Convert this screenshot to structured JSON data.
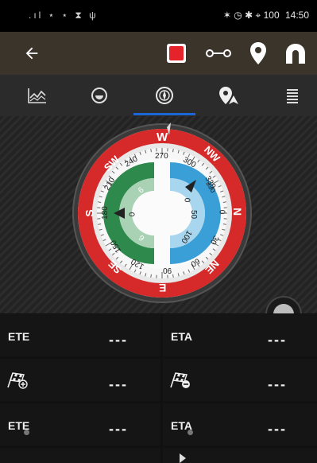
{
  "status_bar": {
    "left_icons": ".ıl ⋆ ⋆ ⧗ ψ",
    "right_icons": "✶ ◷ ✱ ⌖ 100",
    "time": "14:50"
  },
  "toolbar": {
    "back_icon": "arrow-left-icon",
    "record_icon": "record-icon",
    "route_icon": "route-icon",
    "pin_icon": "location-pin-icon",
    "magnet_icon": "magnet-icon"
  },
  "tabs": [
    {
      "icon": "chart-icon",
      "active": false
    },
    {
      "icon": "gauge-icon",
      "active": false
    },
    {
      "icon": "compass-icon",
      "active": true
    },
    {
      "icon": "navigation-pin-icon",
      "active": false
    },
    {
      "icon": "list-icon",
      "active": false
    }
  ],
  "compass": {
    "heading": "W",
    "cardinals": [
      "W",
      "NW",
      "N",
      "NE",
      "E",
      "SE",
      "S",
      "SW"
    ],
    "degree_labels": [
      "270",
      "300",
      "330",
      "0",
      "30",
      "60",
      "90",
      "120",
      "150",
      "180",
      "210",
      "240"
    ],
    "inner_scale_left": [
      "6",
      "0",
      "6"
    ],
    "inner_scale_right": [
      "330",
      "0",
      "50",
      "100"
    ],
    "colors": {
      "ring": "#d62a2a",
      "green": "#2e8a4c",
      "blue": "#3a9fd6"
    }
  },
  "data_rows": [
    {
      "left": {
        "label": "ETE",
        "value": "---"
      },
      "right": {
        "label": "ETA",
        "value": "---"
      }
    },
    {
      "left": {
        "label": "",
        "icon": "checkered-flag-plus-icon",
        "value": "---"
      },
      "right": {
        "label": "",
        "icon": "checkered-flag-minus-icon",
        "value": "---"
      }
    },
    {
      "left": {
        "label": "ETE",
        "value": "---"
      },
      "right": {
        "label": "ETA",
        "value": "---"
      }
    }
  ]
}
